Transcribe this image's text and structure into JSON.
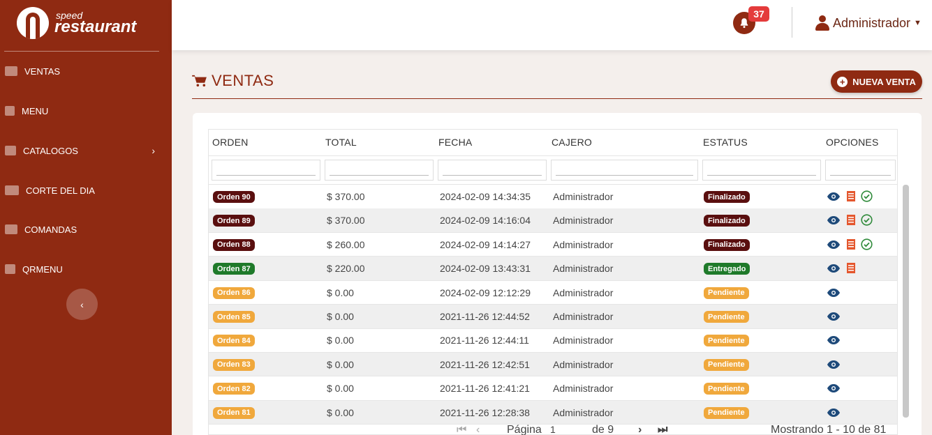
{
  "brand": {
    "small": "speed",
    "big": "restaurant"
  },
  "sidebar": {
    "items": [
      {
        "label": "VENTAS",
        "icon": "money-icon"
      },
      {
        "label": "MENU",
        "icon": "utensils-icon"
      },
      {
        "label": "CATALOGOS",
        "icon": "catalog-icon"
      },
      {
        "label": "CORTE DEL DIA",
        "icon": "chart-icon"
      },
      {
        "label": "COMANDAS",
        "icon": "list-icon"
      },
      {
        "label": "QRMENU",
        "icon": "qr-icon"
      }
    ],
    "collapse_glyph": "‹"
  },
  "topbar": {
    "notification_count": "37",
    "user_name": "Administrador"
  },
  "page": {
    "title": "VENTAS",
    "new_button": "NUEVA VENTA"
  },
  "table": {
    "columns": [
      "ORDEN",
      "TOTAL",
      "FECHA",
      "CAJERO",
      "ESTATUS",
      "OPCIONES"
    ],
    "rows": [
      {
        "orden": "Orden 90",
        "total": "$ 370.00",
        "fecha": "2024-02-09 14:34:35",
        "cajero": "Administrador",
        "estatus": "Finalizado"
      },
      {
        "orden": "Orden 89",
        "total": "$ 370.00",
        "fecha": "2024-02-09 14:16:04",
        "cajero": "Administrador",
        "estatus": "Finalizado"
      },
      {
        "orden": "Orden 88",
        "total": "$ 260.00",
        "fecha": "2024-02-09 14:14:27",
        "cajero": "Administrador",
        "estatus": "Finalizado"
      },
      {
        "orden": "Orden 87",
        "total": "$ 220.00",
        "fecha": "2024-02-09 13:43:31",
        "cajero": "Administrador",
        "estatus": "Entregado"
      },
      {
        "orden": "Orden 86",
        "total": "$ 0.00",
        "fecha": "2024-02-09 12:12:29",
        "cajero": "Administrador",
        "estatus": "Pendiente"
      },
      {
        "orden": "Orden 85",
        "total": "$ 0.00",
        "fecha": "2021-11-26 12:44:52",
        "cajero": "Administrador",
        "estatus": "Pendiente"
      },
      {
        "orden": "Orden 84",
        "total": "$ 0.00",
        "fecha": "2021-11-26 12:44:11",
        "cajero": "Administrador",
        "estatus": "Pendiente"
      },
      {
        "orden": "Orden 83",
        "total": "$ 0.00",
        "fecha": "2021-11-26 12:42:51",
        "cajero": "Administrador",
        "estatus": "Pendiente"
      },
      {
        "orden": "Orden 82",
        "total": "$ 0.00",
        "fecha": "2021-11-26 12:41:21",
        "cajero": "Administrador",
        "estatus": "Pendiente"
      },
      {
        "orden": "Orden 81",
        "total": "$ 0.00",
        "fecha": "2021-11-26 12:28:38",
        "cajero": "Administrador",
        "estatus": "Pendiente"
      }
    ]
  },
  "status_colors": {
    "Finalizado": "#5a0f0f",
    "Entregado": "#1f7a2a",
    "Pendiente": "#f0a83c"
  },
  "pager": {
    "page_label": "Página",
    "page_value": "1",
    "of_label": "de 9",
    "summary": "Mostrando 1 - 10 de 81"
  }
}
